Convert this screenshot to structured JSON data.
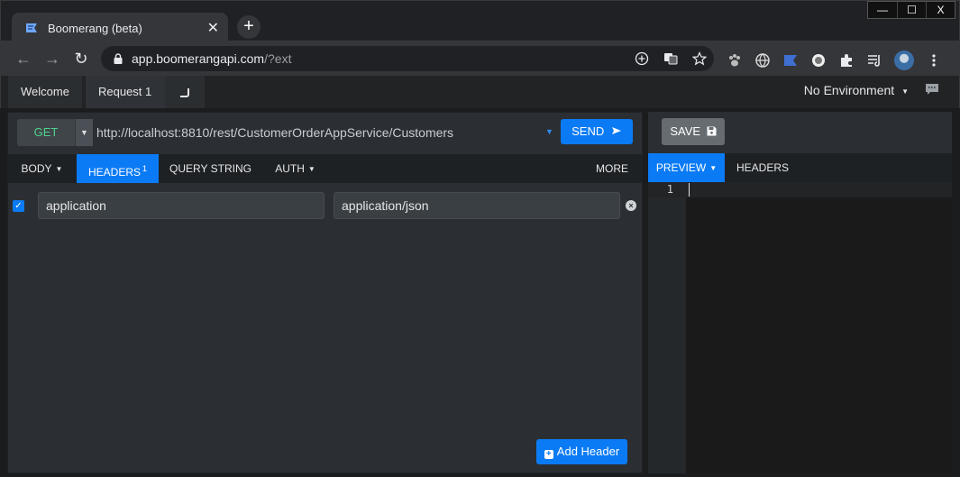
{
  "browser": {
    "tab_title": "Boomerang (beta)",
    "tab_close": "✕",
    "new_tab": "+",
    "window_controls": [
      "—",
      "☐",
      "X"
    ],
    "url_main": "app.boomerangapi.com",
    "url_rest": "/?ext"
  },
  "app_tabs": {
    "welcome": "Welcome",
    "request": "Request 1",
    "environment": "No Environment"
  },
  "request": {
    "method": "GET",
    "url": "http://localhost:8810/rest/CustomerOrderAppService/Customers",
    "send_label": "SEND",
    "tabs": {
      "body": "BODY",
      "headers": "HEADERS",
      "headers_count": "1",
      "query_string": "QUERY STRING",
      "auth": "AUTH",
      "more": "MORE"
    },
    "headers": [
      {
        "enabled": true,
        "key": "application",
        "value": "application/json"
      }
    ],
    "add_header_label": "Add Header"
  },
  "response": {
    "save_label": "SAVE",
    "tabs": {
      "preview": "PREVIEW",
      "headers": "HEADERS"
    },
    "line_number": "1"
  }
}
